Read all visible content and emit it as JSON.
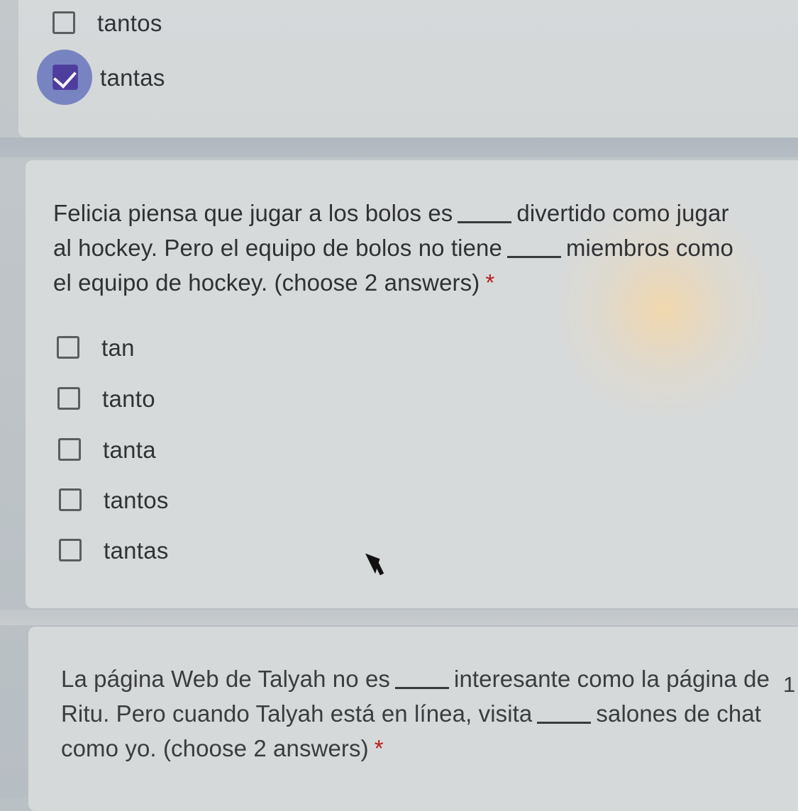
{
  "top_question": {
    "options": [
      {
        "label": "tantos",
        "checked": false
      },
      {
        "label": "tantas",
        "checked": true
      }
    ]
  },
  "middle_question": {
    "text_1": "Felicia piensa que jugar a los bolos es",
    "text_2": "divertido como jugar",
    "text_3": "al hockey. Pero el equipo de bolos no tiene",
    "text_4": "miembros como",
    "text_5": "el equipo de hockey. (choose 2 answers)",
    "required": "*",
    "options": [
      {
        "label": "tan",
        "checked": false
      },
      {
        "label": "tanto",
        "checked": false
      },
      {
        "label": "tanta",
        "checked": false
      },
      {
        "label": "tantos",
        "checked": false
      },
      {
        "label": "tantas",
        "checked": false
      }
    ]
  },
  "bottom_question": {
    "text_1": "La página Web de Talyah no es",
    "text_2": "interesante como la página de",
    "text_3": "Ritu. Pero cuando Talyah está en línea, visita",
    "text_4": "salones de chat",
    "text_5": "como yo. (choose 2 answers)",
    "required": "*",
    "counter": "1"
  },
  "colors": {
    "checked_fill": "#4d3d9d",
    "checked_halo": "#7380c0",
    "required": "#b71c1c"
  },
  "icons": {
    "checked_checkbox": "checkmark-checkbox-icon",
    "unchecked_checkbox": "checkbox-icon",
    "cursor": "mouse-pointer-icon"
  }
}
